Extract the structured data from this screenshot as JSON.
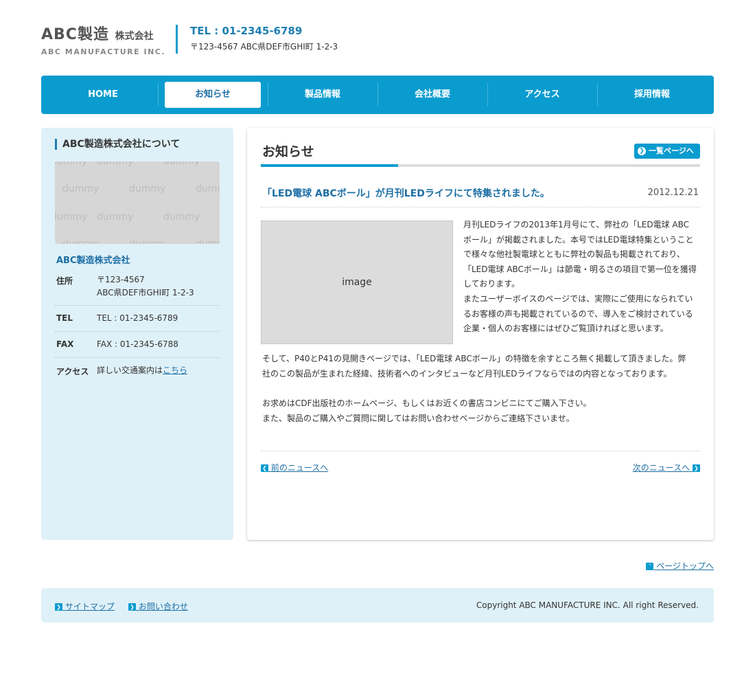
{
  "header": {
    "logo_main": "ABC製造",
    "logo_main_small": "株式会社",
    "logo_sub": "ABC MANUFACTURE INC.",
    "tel": "TEL : 01-2345-6789",
    "address": "〒123-4567 ABC県DEF市GHI町 1-2-3"
  },
  "nav": {
    "items": [
      {
        "label": "HOME"
      },
      {
        "label": "お知らせ"
      },
      {
        "label": "製品情報"
      },
      {
        "label": "会社概要"
      },
      {
        "label": "アクセス"
      },
      {
        "label": "採用情報"
      }
    ],
    "active_index": 1
  },
  "sidebar": {
    "title": "ABC製造株式会社について",
    "image_text": "dummy",
    "company_name": "ABC製造株式会社",
    "rows": [
      {
        "label": "住所",
        "value_line1": "〒123-4567",
        "value_line2": "ABC県DEF市GHI町 1-2-3"
      },
      {
        "label": "TEL",
        "value": "TEL : 01-2345-6789"
      },
      {
        "label": "FAX",
        "value": "FAX : 01-2345-6788"
      },
      {
        "label": "アクセス",
        "value": "詳しい交通案内は",
        "link": "こちら"
      }
    ]
  },
  "main": {
    "title": "お知らせ",
    "list_button": "一覧ページへ",
    "article": {
      "title": "「LED電球 ABCボール」が月刊LEDライフにて特集されました。",
      "date": "2012.12.21",
      "image_label": "image",
      "para1_lines": [
        "月刊LEDライフの2013年1月号にて、弊社の「LED電球 ABC",
        "ボール」が掲載されました。本号ではLED電球特集ということ",
        "で様々な他社製電球とともに弊社の製品も掲載されており、",
        "「LED電球 ABCボール」は節電・明るさの項目で第一位を獲得",
        "しております。",
        "またユーザーボイスのページでは、実際にご使用になられてい",
        "るお客様の声も掲載されているので、導入をご検討されている",
        "企業・個人のお客様にはぜひご覧頂ければと思います。"
      ],
      "para2_lines": [
        "そして、P40とP41の見開きページでは、「LED電球 ABCボール」の特徴を余すところ無く掲載して頂きました。弊",
        "社のこの製品が生まれた経緯、技術者へのインタビューなど月刊LEDライフならではの内容となっております。"
      ],
      "para3_lines": [
        "お求めはCDF出版社のホームページ、もしくはお近くの書店コンビニにてご購入下さい。",
        "また、製品のご購入やご質問に関してはお問い合わせページからご連絡下さいませ。"
      ]
    },
    "prev_link": "前のニュースへ",
    "next_link": "次のニュースへ"
  },
  "pagetop": "ページトップへ",
  "footer": {
    "sitemap": "サイトマップ",
    "contact": "お問い合わせ",
    "copyright": "Copyright ABC MANUFACTURE INC. All right Reserved."
  },
  "colors": {
    "accent": "#0b9ccf",
    "link": "#1d6fa5",
    "sidebar_bg": "#dff1f8"
  }
}
